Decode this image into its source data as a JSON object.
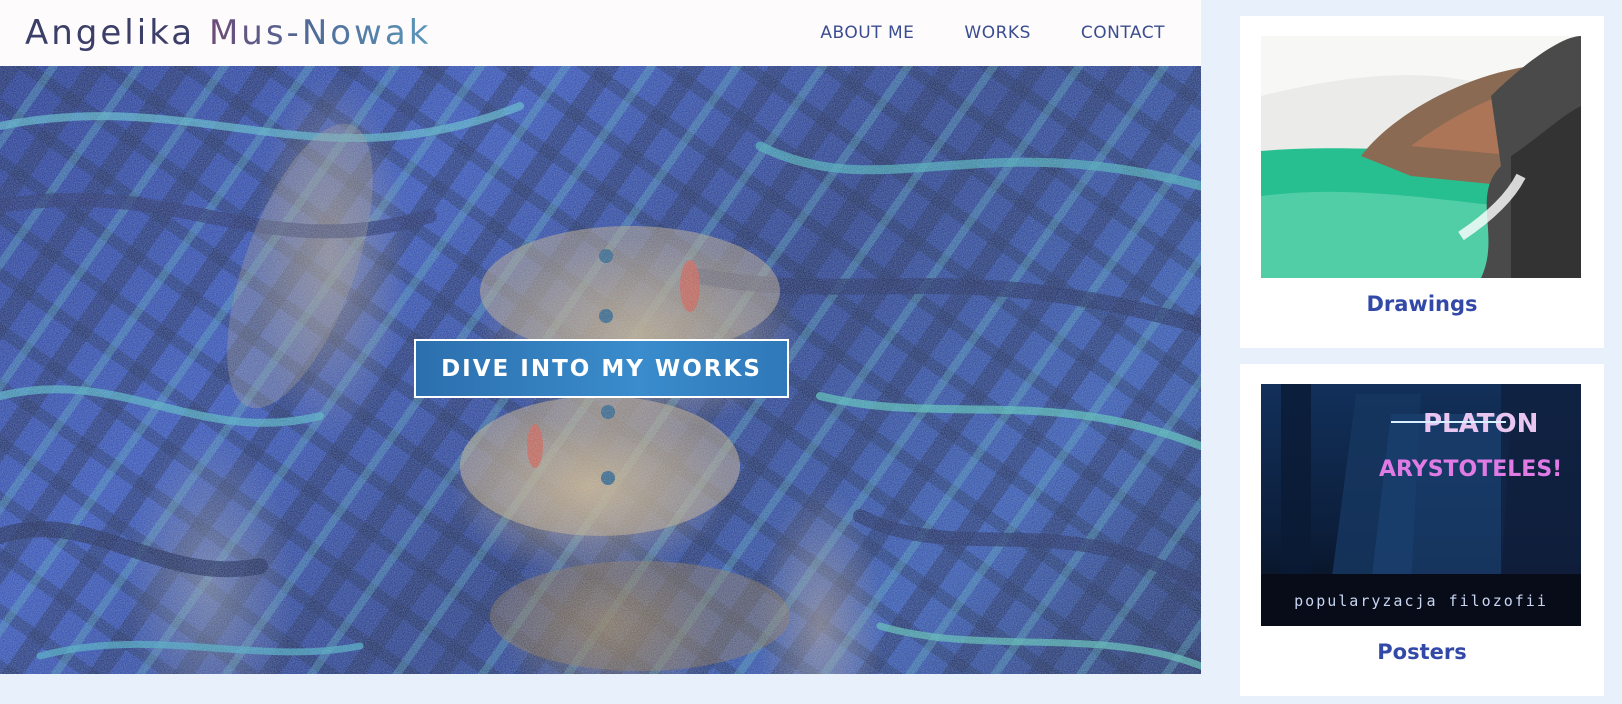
{
  "header": {
    "logo_first": "Angelika",
    "logo_last": "Mus-Nowak",
    "nav": [
      {
        "label": "ABOUT ME"
      },
      {
        "label": "WORKS"
      },
      {
        "label": "CONTACT"
      }
    ]
  },
  "hero": {
    "cta_label": "DIVE INTO MY WORKS"
  },
  "sidebar": {
    "cards": [
      {
        "label": "Drawings"
      },
      {
        "label": "Posters",
        "poster_line1": "PLATON",
        "poster_line2": "ARYSTOTELES!",
        "poster_caption": "popularyzacja filozofii"
      }
    ]
  },
  "colors": {
    "page_bg": "#e7f0fb",
    "nav_text": "#3a4d90",
    "card_title": "#3349a8",
    "cta_bg": "#3a8ccc"
  }
}
